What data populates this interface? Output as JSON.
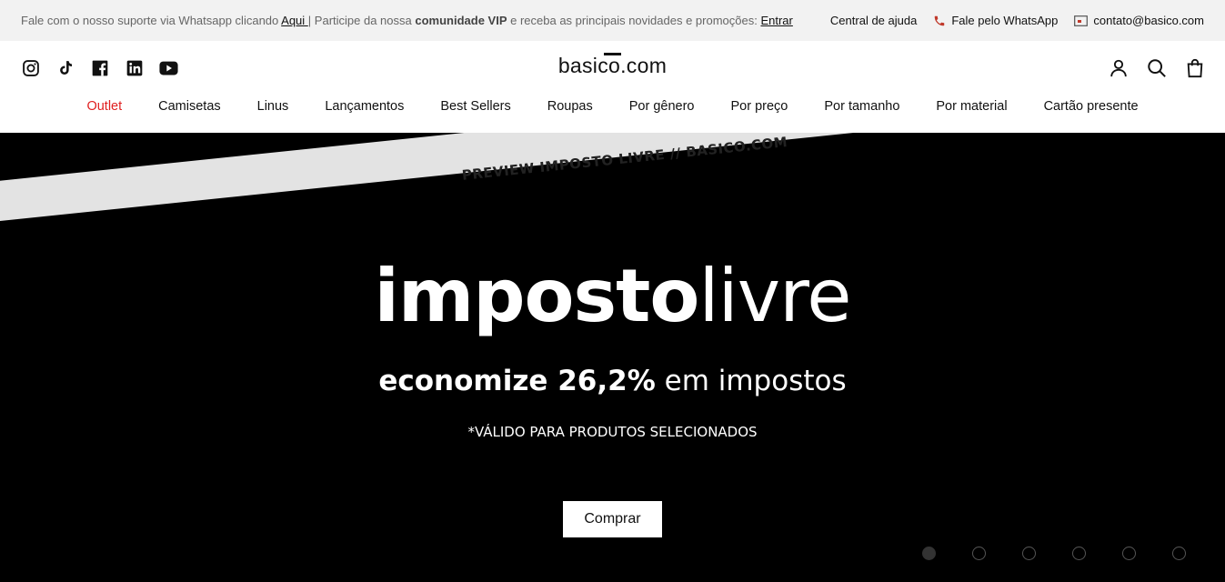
{
  "announcement": {
    "text_before": "Fale com o nosso suporte via Whatsapp clicando ",
    "link1": "Aqui ",
    "separator": "|",
    "text_mid": " Participe da nossa ",
    "bold": "comunidade VIP",
    "text_after": " e receba as principais novidades e promoções: ",
    "link2": "Entrar",
    "help": "Central de ajuda",
    "whatsapp": "Fale pelo WhatsApp",
    "email": "contato@basico.com"
  },
  "header": {
    "logo": "basico.com",
    "socials": [
      "instagram-icon",
      "tiktok-icon",
      "facebook-icon",
      "linkedin-icon",
      "youtube-icon"
    ],
    "icons": [
      "account-icon",
      "search-icon",
      "bag-icon"
    ]
  },
  "nav": {
    "items": [
      "Outlet",
      "Camisetas",
      "Linus",
      "Lançamentos",
      "Best Sellers",
      "Roupas",
      "Por gênero",
      "Por preço",
      "Por tamanho",
      "Por material",
      "Cartão presente"
    ],
    "outlet_color": "#e02020"
  },
  "hero": {
    "ribbon": "PREVIEW IMPOSTO LIVRE // BASICO.COM",
    "title_bold": "imposto",
    "title_light": "livre",
    "subtitle_bold": "economize 26,2%",
    "subtitle_light": " em impostos",
    "note": "*VÁLIDO PARA PRODUTOS SELECIONADOS",
    "button": "Comprar",
    "slides_count": 6,
    "active_slide": 1
  }
}
